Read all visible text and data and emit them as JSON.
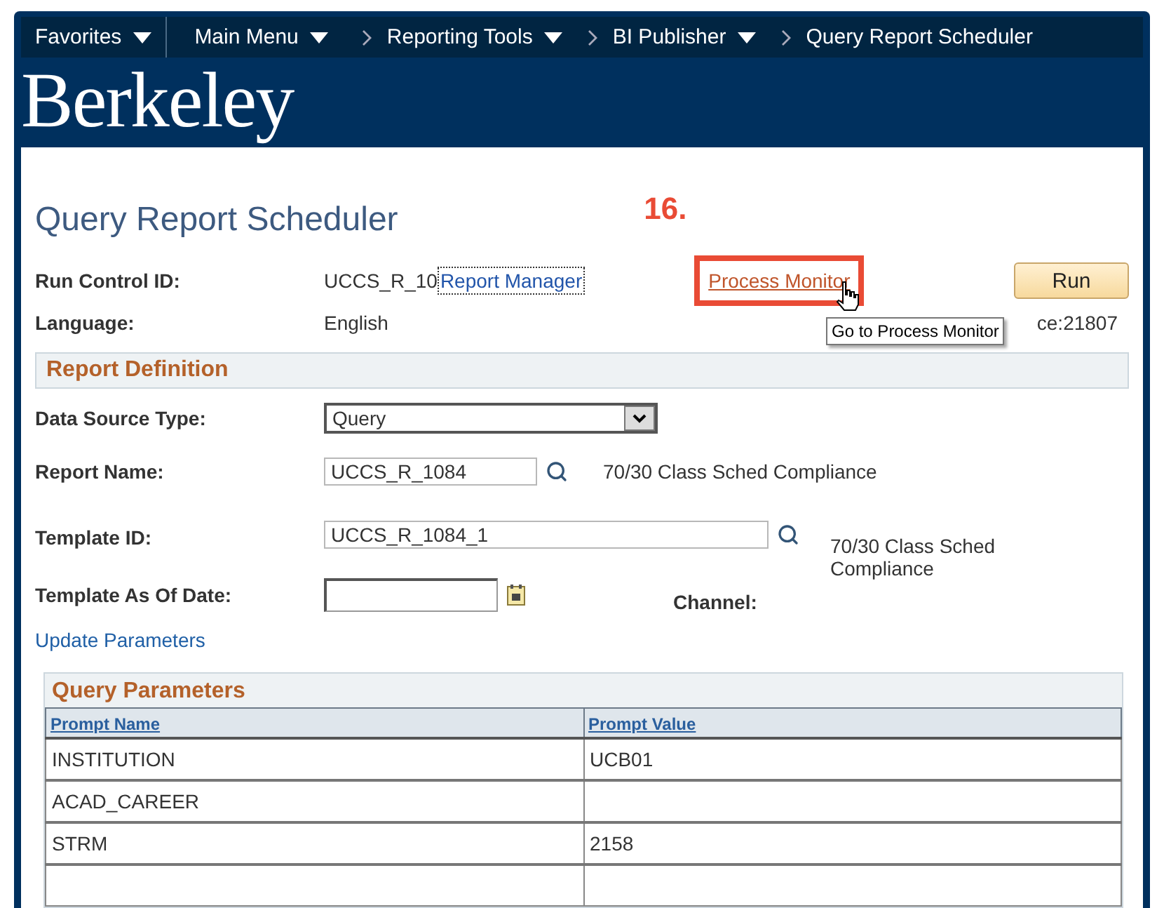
{
  "nav": {
    "items": [
      {
        "label": "Favorites",
        "kind": "menu"
      },
      {
        "label": "Main Menu",
        "kind": "menu"
      },
      {
        "label": "Reporting Tools",
        "kind": "crumb"
      },
      {
        "label": "BI Publisher",
        "kind": "crumb"
      },
      {
        "label": "Query Report Scheduler",
        "kind": "current"
      }
    ]
  },
  "logo": "Berkeley",
  "page_title": "Query Report Scheduler",
  "annotation": {
    "step": "16."
  },
  "run_control": {
    "label": "Run Control ID:",
    "value": "UCCS_R_10",
    "overlay_link": "Report Manager"
  },
  "process_monitor_link": "Process Monitor",
  "run_button": "Run",
  "tooltip": "Go to Process Monitor",
  "language": {
    "label": "Language:",
    "value": "English"
  },
  "process_instance": "ce:21807",
  "report_definition": {
    "title": "Report Definition",
    "data_source_type": {
      "label": "Data Source Type:",
      "value": "Query"
    },
    "report_name": {
      "label": "Report Name:",
      "value": "UCCS_R_1084",
      "description": "70/30 Class Sched Compliance"
    },
    "template_id": {
      "label": "Template ID:",
      "value": "UCCS_R_1084_1",
      "description": "70/30 Class Sched Compliance"
    },
    "template_as_of_date": {
      "label": "Template As Of Date:"
    },
    "channel": {
      "label": "Channel:"
    }
  },
  "update_parameters_link": "Update Parameters",
  "query_parameters": {
    "title": "Query Parameters",
    "columns": [
      "Prompt Name",
      "Prompt Value"
    ],
    "rows": [
      [
        "INSTITUTION",
        "UCB01"
      ],
      [
        "ACAD_CAREER",
        ""
      ],
      [
        "STRM",
        "2158"
      ]
    ]
  }
}
